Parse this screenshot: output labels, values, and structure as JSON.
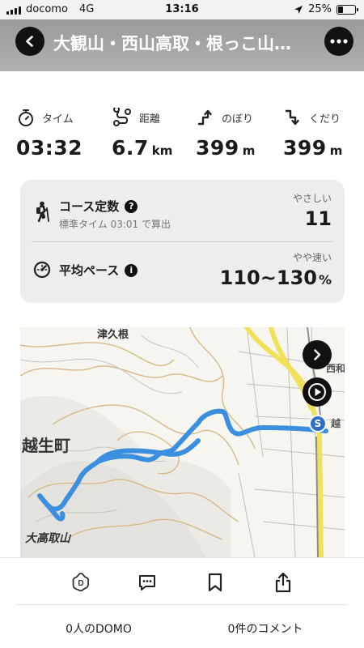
{
  "status_bar": {
    "carrier": "docomo",
    "network": "4G",
    "time": "13:16",
    "battery": "25%",
    "battery_level": 0.25
  },
  "header": {
    "title": "大観山・西山高取・根っこ山…",
    "back_icon": "chevron-left-icon",
    "more_icon": "more-icon"
  },
  "stats": [
    {
      "label": "タイム",
      "value": "03:32",
      "unit": "",
      "icon": "stopwatch-icon"
    },
    {
      "label": "距離",
      "value": "6.7",
      "unit": "km",
      "icon": "route-icon"
    },
    {
      "label": "のぼり",
      "value": "399",
      "unit": "m",
      "icon": "ascent-icon"
    },
    {
      "label": "くだり",
      "value": "399",
      "unit": "m",
      "icon": "descent-icon"
    }
  ],
  "course": {
    "title": "コース定数",
    "subtitle": "標準タイム 03:01 で算出",
    "tag": "やさしい",
    "value": "11"
  },
  "pace": {
    "title": "平均ペース",
    "tag": "やや速い",
    "value": "110~130",
    "unit": "%"
  },
  "map": {
    "labels": {
      "town": "越生町",
      "mountain": "大高取山",
      "top_label": "津久根",
      "corner": "西和",
      "side": "越"
    },
    "start_marker": "S",
    "route_color": "#3b8fde"
  },
  "actions": {
    "domo_icon": "domo-icon",
    "comment_icon": "comment-icon",
    "bookmark_icon": "bookmark-icon",
    "share_icon": "share-icon"
  },
  "counts": {
    "domo": "0人のDOMO",
    "comments": "0件のコメント"
  }
}
